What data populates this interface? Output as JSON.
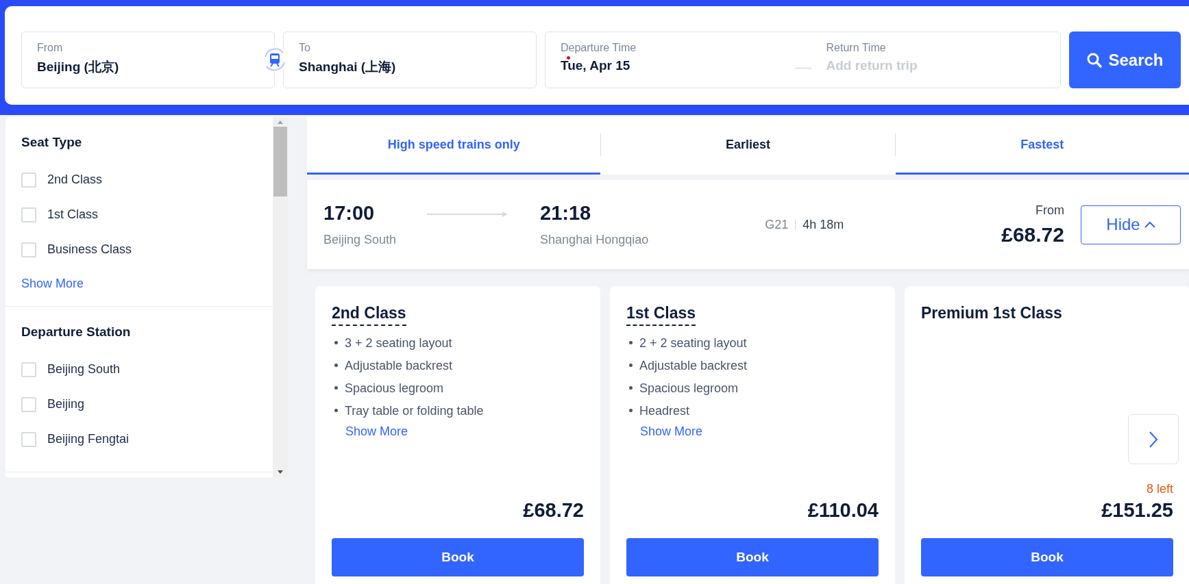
{
  "search": {
    "from": {
      "label": "From",
      "value": "Beijing (北京)"
    },
    "to": {
      "label": "To",
      "value": "Shanghai (上海)"
    },
    "departure": {
      "label": "Departure Time",
      "value": "Tue, Apr 15"
    },
    "return": {
      "label": "Return Time",
      "placeholder": "Add return trip"
    },
    "button": "Search"
  },
  "filters": [
    {
      "title": "Seat Type",
      "options": [
        {
          "label": "2nd Class",
          "checked": false
        },
        {
          "label": "1st Class",
          "checked": false
        },
        {
          "label": "Business Class",
          "checked": false
        }
      ],
      "show_more": "Show More"
    },
    {
      "title": "Departure Station",
      "options": [
        {
          "label": "Beijing South",
          "checked": false
        },
        {
          "label": "Beijing",
          "checked": false
        },
        {
          "label": "Beijing Fengtai",
          "checked": false
        }
      ]
    }
  ],
  "sort_tabs": [
    {
      "label": "High speed trains only",
      "selected": true
    },
    {
      "label": "Earliest",
      "selected": false
    },
    {
      "label": "Fastest",
      "selected": true
    }
  ],
  "train": {
    "depart_time": "17:00",
    "depart_station": "Beijing South",
    "arrive_time": "21:18",
    "arrive_station": "Shanghai Hongqiao",
    "number": "G21",
    "duration": "4h 18m",
    "price_label": "From",
    "price": "£68.72",
    "hide_button": "Hide"
  },
  "fares": [
    {
      "title": "2nd Class",
      "features": [
        "3 + 2 seating layout",
        "Adjustable backrest",
        "Spacious legroom",
        "Tray table or folding table"
      ],
      "show_more": "Show More",
      "price": "£68.72",
      "button": "Book"
    },
    {
      "title": "1st Class",
      "features": [
        "2 + 2 seating layout",
        "Adjustable backrest",
        "Spacious legroom",
        "Headrest"
      ],
      "show_more": "Show More",
      "price": "£110.04",
      "button": "Book"
    },
    {
      "title": "Premium 1st Class",
      "availability": "8 left",
      "price": "£151.25",
      "button": "Book"
    }
  ]
}
